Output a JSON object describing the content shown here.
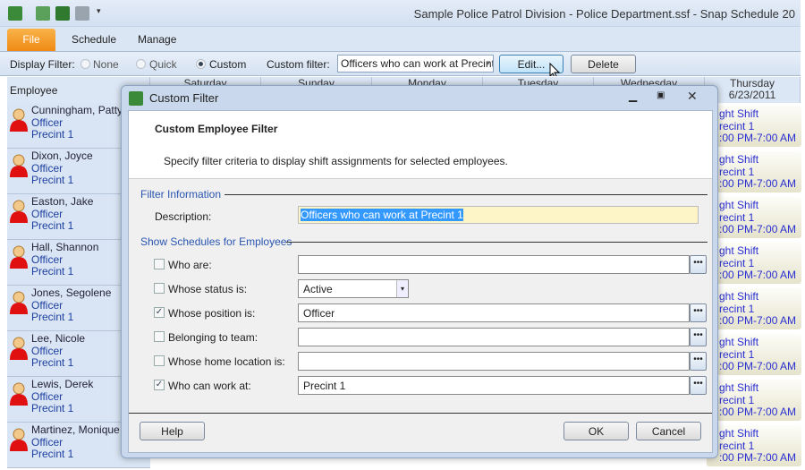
{
  "window": {
    "title": "Sample Police Patrol Division - Police Department.ssf - Snap Schedule 20"
  },
  "ribbon": {
    "tabs": [
      {
        "label": "File"
      },
      {
        "label": "Schedule"
      },
      {
        "label": "Manage"
      }
    ]
  },
  "filterbar": {
    "display_filter_label": "Display Filter:",
    "none": "None",
    "quick": "Quick",
    "custom": "Custom",
    "selected": "Custom",
    "custom_filter_label": "Custom filter:",
    "custom_filter_value": "Officers who can work at Precint",
    "edit": "Edit...",
    "delete": "Delete"
  },
  "grid": {
    "employee_header": "Employee",
    "days": [
      {
        "label": "Saturday"
      },
      {
        "label": "Sunday"
      },
      {
        "label": "Monday"
      },
      {
        "label": "Tuesday"
      },
      {
        "label": "Wednesday"
      },
      {
        "label": "Thursday",
        "date": "6/23/2011"
      }
    ],
    "employees": [
      {
        "name": "Cunningham, Patty",
        "position": "Officer",
        "location": "Precint 1"
      },
      {
        "name": "Dixon, Joyce",
        "position": "Officer",
        "location": "Precint 1"
      },
      {
        "name": "Easton, Jake",
        "position": "Officer",
        "location": "Precint 1"
      },
      {
        "name": "Hall, Shannon",
        "position": "Officer",
        "location": "Precint 1"
      },
      {
        "name": "Jones, Segolene",
        "position": "Officer",
        "location": "Precint 1"
      },
      {
        "name": "Lee, Nicole",
        "position": "Officer",
        "location": "Precint 1"
      },
      {
        "name": "Lewis, Derek",
        "position": "Officer",
        "location": "Precint 1"
      },
      {
        "name": "Martinez, Monique",
        "position": "Officer",
        "location": "Precint 1"
      }
    ],
    "thursday_shift": {
      "line1": "ght Shift",
      "line2": "recint 1",
      "line3": ":00 PM-7:00 AM"
    }
  },
  "dialog": {
    "title": "Custom Filter",
    "heading": "Custom Employee Filter",
    "description_text": "Specify filter criteria to display shift assignments for selected employees.",
    "filter_info_label": "Filter Information",
    "description_label": "Description:",
    "description_value": "Officers who can work at Precint 1",
    "show_label": "Show Schedules for Employees",
    "criteria": [
      {
        "label": "Who are:",
        "checked": false,
        "value": ""
      },
      {
        "label": "Whose status is:",
        "checked": false,
        "value": "Active"
      },
      {
        "label": "Whose position is:",
        "checked": true,
        "value": "Officer"
      },
      {
        "label": "Belonging to team:",
        "checked": false,
        "value": ""
      },
      {
        "label": "Whose home location is:",
        "checked": false,
        "value": ""
      },
      {
        "label": "Who can work at:",
        "checked": true,
        "value": "Precint 1"
      }
    ],
    "help": "Help",
    "ok": "OK",
    "cancel": "Cancel"
  }
}
